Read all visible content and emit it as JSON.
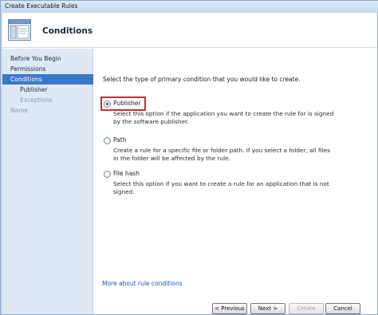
{
  "window": {
    "title": "Create Executable Rules"
  },
  "header": {
    "title": "Conditions",
    "icon": "wizard-page-icon"
  },
  "nav": {
    "items": [
      {
        "label": "Before You Begin",
        "state": "normal"
      },
      {
        "label": "Permissions",
        "state": "normal"
      },
      {
        "label": "Conditions",
        "state": "active"
      },
      {
        "label": "Publisher",
        "state": "normal"
      },
      {
        "label": "Exceptions",
        "state": "disabled"
      },
      {
        "label": "Name",
        "state": "disabled"
      }
    ]
  },
  "main": {
    "intro": "Select the type of primary condition that you would like to create.",
    "options": [
      {
        "label": "Publisher",
        "checked": true,
        "description": "Select this option if the application you want to create the rule for is signed by the software publisher."
      },
      {
        "label": "Path",
        "checked": false,
        "description": "Create a rule for a specific file or folder path. If you select a folder, all files in the folder will be affected by the rule."
      },
      {
        "label": "File hash",
        "checked": false,
        "description": "Select this option if you want to create a rule for an application that is not signed."
      }
    ],
    "link": "More about rule conditions"
  },
  "buttons": {
    "previous": "< Previous",
    "next": "Next >",
    "create": "Create",
    "cancel": "Cancel"
  },
  "colors": {
    "accent": "#3b78c8",
    "highlight_box": "#c0302c",
    "link": "#1f55a8"
  }
}
